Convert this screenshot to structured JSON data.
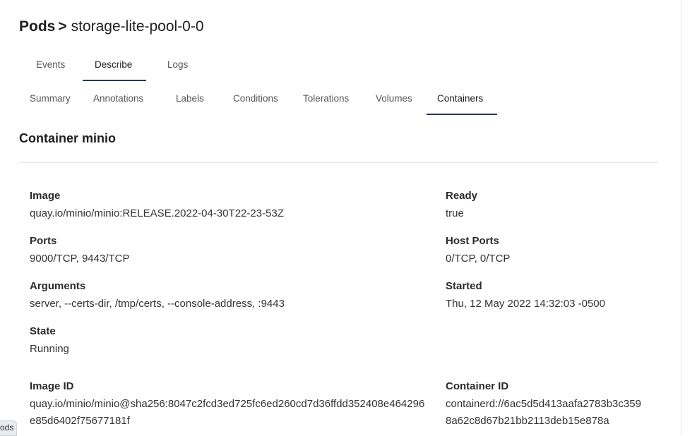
{
  "breadcrumb": {
    "root": "Pods",
    "separator": ">",
    "current": "storage-lite-pool-0-0"
  },
  "top_tabs": [
    {
      "label": "Events"
    },
    {
      "label": "Describe",
      "active": true
    },
    {
      "label": "Logs"
    }
  ],
  "sub_tabs": [
    {
      "label": "Summary"
    },
    {
      "label": "Annotations"
    },
    {
      "label": "Labels"
    },
    {
      "label": "Conditions"
    },
    {
      "label": "Tolerations"
    },
    {
      "label": "Volumes"
    },
    {
      "label": "Containers",
      "active": true
    }
  ],
  "container": {
    "title": "Container minio",
    "image_label": "Image",
    "image": "quay.io/minio/minio:RELEASE.2022-04-30T22-23-53Z",
    "ready_label": "Ready",
    "ready": "true",
    "ports_label": "Ports",
    "ports": "9000/TCP, 9443/TCP",
    "host_ports_label": "Host Ports",
    "host_ports": "0/TCP, 0/TCP",
    "arguments_label": "Arguments",
    "arguments": "server, --certs-dir, /tmp/certs, --console-address, :9443",
    "started_label": "Started",
    "started": "Thu, 12 May 2022 14:32:03 -0500",
    "state_label": "State",
    "state": "Running",
    "image_id_label": "Image ID",
    "image_id": "quay.io/minio/minio@sha256:8047c2fcd3ed725fc6ed260cd7d36ffdd352408e464296e85d6402f75677181f",
    "container_id_label": "Container ID",
    "container_id": "containerd://6ac5d5d413aafa2783b3c3598a62c8d67b21bb2113deb15e878a"
  },
  "footer_pill": "ods"
}
